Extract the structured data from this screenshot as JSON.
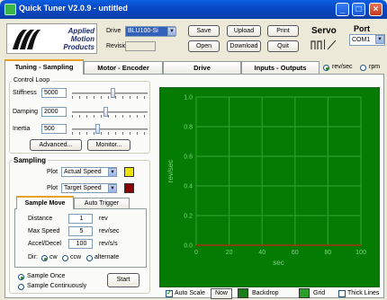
{
  "window": {
    "title": "Quick Tuner  V2.0.9 - untitled",
    "minimize": "_",
    "maximize": "□",
    "close": "×"
  },
  "header": {
    "logo": "Applied Motion Products",
    "drive_label": "Drive",
    "drive_value": "BLU100-Si",
    "revision_label": "Revision",
    "buttons": {
      "save": "Save",
      "upload": "Upload",
      "print": "Print",
      "open": "Open",
      "download": "Download",
      "quit": "Quit"
    },
    "servo_label": "Servo",
    "port_label": "Port",
    "port_value": "COM1"
  },
  "tabs": [
    {
      "label": "Tuning - Sampling",
      "active": true
    },
    {
      "label": "Motor - Encoder",
      "active": false
    },
    {
      "label": "Drive",
      "active": false
    },
    {
      "label": "Inputs - Outputs",
      "active": false
    }
  ],
  "units": {
    "rev_sec": "rev/sec",
    "rpm": "rpm",
    "selected": "rev/sec"
  },
  "control_loop": {
    "title": "Control Loop",
    "stiffness": {
      "label": "Stiffness",
      "value": "5000",
      "level": 0.55
    },
    "damping": {
      "label": "Damping",
      "value": "2000",
      "level": 0.44
    },
    "inertia": {
      "label": "Inertia",
      "value": "500",
      "level": 0.33
    },
    "advanced": "Advanced...",
    "monitor": "Monitor..."
  },
  "sampling": {
    "title": "Sampling",
    "plot1_label": "Plot",
    "plot1_value": "Actual Speed",
    "plot1_color": "#f0e000",
    "plot2_label": "Plot",
    "plot2_value": "Target Speed",
    "plot2_color": "#8b0000",
    "tab_sample_move": "Sample Move",
    "tab_auto_trigger": "Auto Trigger",
    "distance_label": "Distance",
    "distance_value": "1",
    "distance_unit": "rev",
    "maxspeed_label": "Max Speed",
    "maxspeed_value": "5",
    "maxspeed_unit": "rev/sec",
    "accel_label": "Accel/Decel",
    "accel_value": "100",
    "accel_unit": "rev/s/s",
    "dir_label": "Dir:",
    "dir_cw": "cw",
    "dir_ccw": "ccw",
    "dir_alternate": "alternate",
    "dir_selected": "cw",
    "sample_once": "Sample Once",
    "sample_continuously": "Sample Continuously",
    "sample_selected": "once",
    "start": "Start"
  },
  "plot_footer": {
    "auto_scale": "Auto Scale",
    "auto_scale_checked": true,
    "now": "Now",
    "backdrop": "Backdrop",
    "backdrop_color": "#1c7c1c",
    "grid": "Grid",
    "grid_color": "#2aa02a",
    "thick_lines": "Thick Lines",
    "thick_lines_checked": false
  },
  "chart_data": {
    "type": "line",
    "xlabel": "sec",
    "ylabel": "rev/sec",
    "xlim": [
      0,
      100
    ],
    "ylim": [
      0,
      1.0
    ],
    "xticks": [
      "0",
      "20",
      "40",
      "60",
      "80",
      "100"
    ],
    "yticks": [
      "0.0",
      "0.2",
      "0.4",
      "0.6",
      "0.8",
      "1.0"
    ],
    "grid": true,
    "series": [
      {
        "color": "#f0e000",
        "x": [
          0,
          100
        ],
        "y": [
          0,
          0
        ]
      },
      {
        "color": "#a01010",
        "x": [
          0,
          100
        ],
        "y": [
          0,
          0
        ]
      }
    ]
  }
}
